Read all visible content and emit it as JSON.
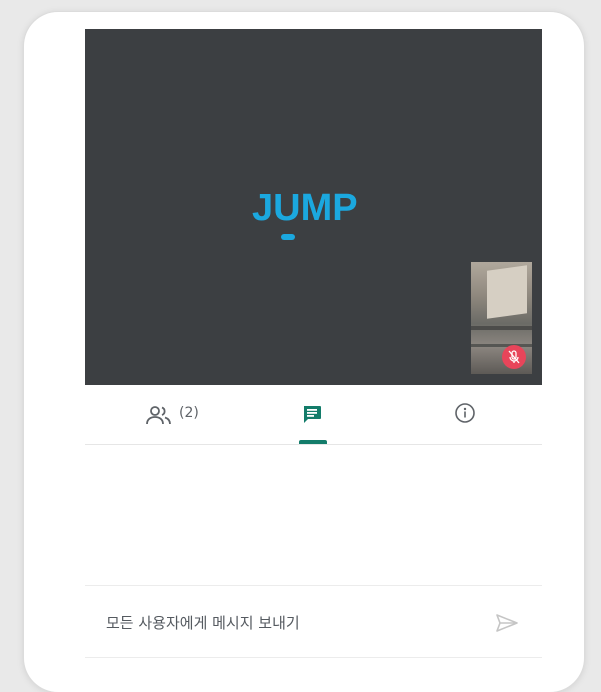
{
  "video": {
    "logo_text": "JUMP",
    "logo_color": "#1ba8df",
    "self_view_muted": true
  },
  "tabs": [
    {
      "name": "participants",
      "icon": "people-icon",
      "count_label": "(2)"
    },
    {
      "name": "chat",
      "icon": "chat-icon",
      "active": true
    },
    {
      "name": "info",
      "icon": "info-icon"
    }
  ],
  "composer": {
    "placeholder": "모든 사용자에게 메시지 보내기",
    "send_icon": "send-icon"
  },
  "colors": {
    "accent": "#137c6a",
    "video_bg": "#3c3f42",
    "mute_badge": "#e8455a"
  }
}
